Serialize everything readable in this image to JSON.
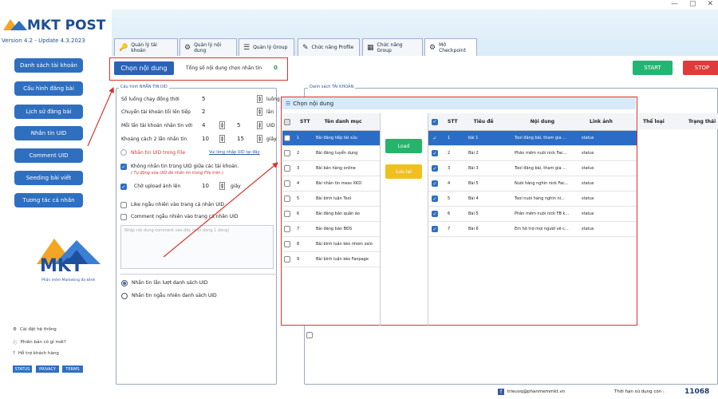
{
  "app": {
    "title": "MKT POST",
    "version": "Version 4.2 - Update 4.3.2023",
    "window_controls": [
      "—",
      "▢",
      "✕"
    ]
  },
  "tabs": [
    {
      "label": "Quản lý tài khoản",
      "icon": "key-icon"
    },
    {
      "label": "Quản lý nội dung",
      "icon": "settings-icon"
    },
    {
      "label": "Quản lý Group",
      "icon": "list-icon"
    },
    {
      "label": "Chức năng Profile",
      "icon": "pen-icon"
    },
    {
      "label": "Chức năng Group",
      "icon": "grid-icon"
    },
    {
      "label": "Mở Checkpoint",
      "icon": "gear-icon"
    }
  ],
  "sidebar": {
    "items": [
      {
        "label": "Danh sách tài khoản"
      },
      {
        "label": "Cấu hình đăng bài"
      },
      {
        "label": "Lịch sử đăng bài"
      },
      {
        "label": "Nhắn tin UID"
      },
      {
        "label": "Comment UID"
      },
      {
        "label": "Seeding bài viết"
      },
      {
        "label": "Tương tác cá nhân"
      }
    ],
    "brand": {
      "name": "MKT",
      "tagline": "Phần mềm Marketing đa kênh"
    },
    "settings": [
      {
        "label": "Cài đặt hệ thống",
        "icon": "gear-icon"
      },
      {
        "label": "Phiên bản có gì mới?",
        "icon": "info-icon"
      },
      {
        "label": "Hỗ trợ khách hàng",
        "icon": "help-icon"
      }
    ],
    "badges": [
      "STATUS",
      "PRIVACY",
      "TERMS"
    ]
  },
  "toolbar": {
    "choose_content": "Chọn nội dung",
    "total_label": "Tổng số nội dung chọn nhắn tin",
    "total_value": "0",
    "start": "START",
    "stop": "STOP"
  },
  "config": {
    "group_title": "Cấu hình NHẮN TIN UID",
    "rows": [
      {
        "label": "Số luồng chạy đồng thời",
        "value": "5",
        "unit": "luồng"
      },
      {
        "label": "Chuyển tài khoản tối lên tiếp",
        "value": "2",
        "unit": "lần"
      },
      {
        "label": "Mỗi lần tài khoản nhắn tin với",
        "value": "4",
        "value2": "5",
        "unit": "UID"
      },
      {
        "label": "Khoảng cách 2 lần nhắn tin",
        "value": "10",
        "value2": "15",
        "unit": "giây"
      }
    ],
    "uid_from_file": "Nhắn tin UID trong File",
    "import_link": "Vui lòng nhập UID tại đây",
    "no_dup_label": "Không nhắn tin trùng UID giữa các tài khoản.",
    "no_dup_note": "( Tự động xóa UID đã nhắn tin trong File trên )",
    "wait_upload": "Chờ upload ảnh lên",
    "wait_value": "10",
    "wait_unit": "giây",
    "like_random": "Like ngẫu nhiên vào trang cá nhân UID",
    "comment_random": "Comment ngẫu nhiên vào trang cá nhân UID",
    "comment_placeholder": "Nhập nội dung comment vào đây (mỗi dòng 1 dòng)",
    "radio1": "Nhắn tin lần lượt danh sách UID",
    "radio2": "Nhắn tin ngẫu nhiên danh sách UID"
  },
  "account_list": {
    "group_title": "Danh sách TÀI KHOẢN"
  },
  "dialog": {
    "title": "Chọn nội dung",
    "left_headers": [
      "STT",
      "Tên danh mục"
    ],
    "categories": [
      {
        "stt": "1",
        "name": "Bài đăng tiếp tài sửu"
      },
      {
        "stt": "2",
        "name": "Bài đăng tuyển dụng"
      },
      {
        "stt": "3",
        "name": "Bài bán hàng online"
      },
      {
        "stt": "4",
        "name": "Bài nhắn tin mess XKD"
      },
      {
        "stt": "5",
        "name": "Bài bình luận Tool"
      },
      {
        "stt": "6",
        "name": "Bài đăng bán quần áo"
      },
      {
        "stt": "7",
        "name": "Bài đăng bán BĐS"
      },
      {
        "stt": "8",
        "name": "Bài bình luận kéo nhóm zalo"
      },
      {
        "stt": "9",
        "name": "Bài bình luận kéo Fanpage"
      }
    ],
    "load": "Load",
    "save": "Lưu lại",
    "right_headers": [
      "STT",
      "Tiêu đề",
      "Nội dung",
      "Link ảnh"
    ],
    "posts": [
      {
        "stt": "1",
        "title": "bài 1",
        "content": "Tool đăng bài, tham gia ...",
        "link": "status"
      },
      {
        "stt": "2",
        "title": "Bài 2",
        "content": "Phần mềm nuôi nick Fac...",
        "link": "status"
      },
      {
        "stt": "3",
        "title": "Bài 3",
        "content": "Tool đăng bài, tham gia ...",
        "link": "status"
      },
      {
        "stt": "4",
        "title": "Bài 5",
        "content": "Nuôi hàng nghìn nick Fac...",
        "link": "status"
      },
      {
        "stt": "5",
        "title": "Bài 4",
        "content": "Tool nuôi hàng nghìn ni...",
        "link": "status"
      },
      {
        "stt": "6",
        "title": "Bài 5",
        "content": "Phần mềm nuôi nick FB k...",
        "link": "status"
      },
      {
        "stt": "7",
        "title": "Bài 6",
        "content": "Em hỗ trợ mọi người về c...",
        "link": "status"
      }
    ]
  },
  "right_columns": [
    "Thể loại",
    "Trạng thái"
  ],
  "footer": {
    "email": "trieuvq@phanmemmkt.vn",
    "expiry_label": "Thời hạn sử dụng còn :",
    "expiry_value": "11068"
  },
  "colors": {
    "primary": "#2f6fc0",
    "start": "#22b573",
    "stop": "#e03a3a",
    "highlight": "#d9342b"
  }
}
